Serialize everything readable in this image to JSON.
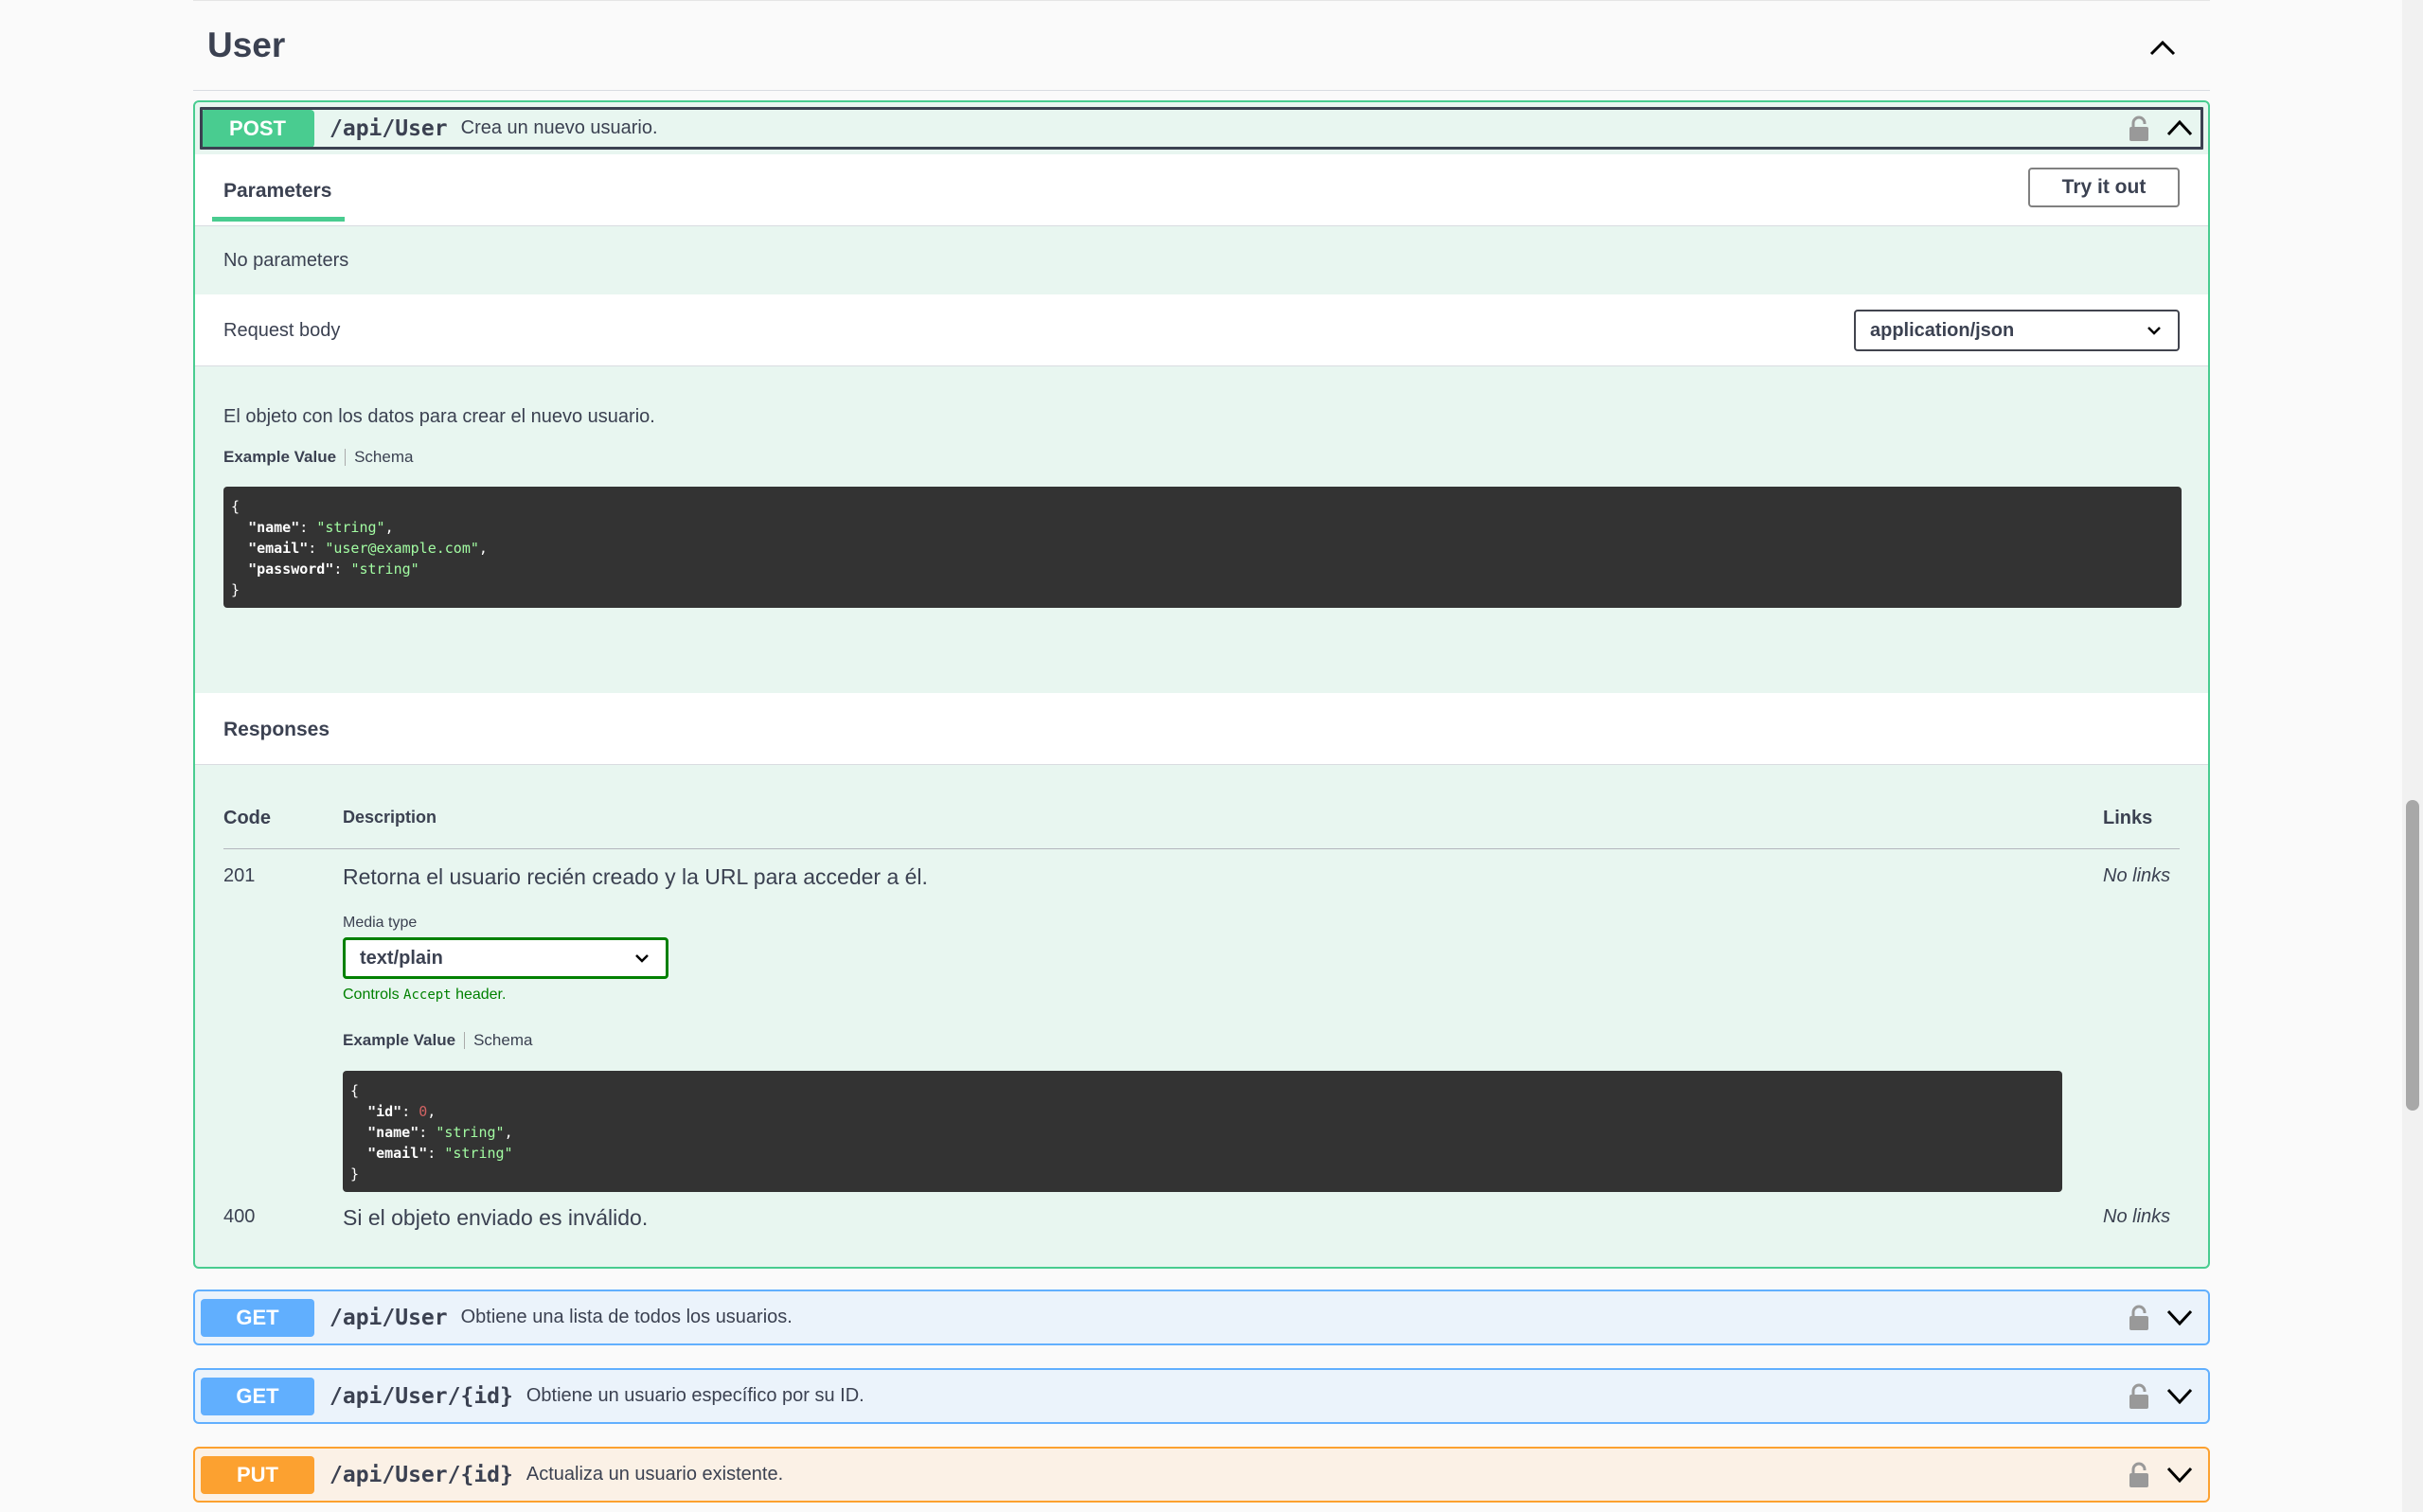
{
  "tag": {
    "title": "User"
  },
  "operations": [
    {
      "method": "POST",
      "path": "/api/User",
      "description": "Crea un nuevo usuario."
    },
    {
      "method": "GET",
      "path": "/api/User",
      "description": "Obtiene una lista de todos los usuarios."
    },
    {
      "method": "GET",
      "path": "/api/User/{id}",
      "description": "Obtiene un usuario específico por su ID."
    },
    {
      "method": "PUT",
      "path": "/api/User/{id}",
      "description": "Actualiza un usuario existente."
    }
  ],
  "expanded": {
    "parameters_tab": "Parameters",
    "try_button": "Try it out",
    "no_parameters": "No parameters",
    "request_body_label": "Request body",
    "request_content_type": "application/json",
    "request_description": "El objeto con los datos para crear el nuevo usuario.",
    "example_value_label": "Example Value",
    "schema_label": "Schema",
    "request_example": {
      "open": "{",
      "l1k": "\"name\"",
      "l1v": "\"string\"",
      "l2k": "\"email\"",
      "l2v": "\"user@example.com\"",
      "l3k": "\"password\"",
      "l3v": "\"string\"",
      "close": "}"
    },
    "responses_label": "Responses",
    "columns": {
      "code": "Code",
      "description": "Description",
      "links": "Links"
    },
    "responses": [
      {
        "code": "201",
        "description": "Retorna el usuario recién creado y la URL para acceder a él.",
        "links": "No links"
      },
      {
        "code": "400",
        "description": "Si el objeto enviado es inválido.",
        "links": "No links"
      }
    ],
    "media_type_label": "Media type",
    "media_type_value": "text/plain",
    "controls_prefix": "Controls",
    "controls_code": "Accept",
    "controls_suffix": "header.",
    "response_example": {
      "open": "{",
      "l1k": "\"id\"",
      "l1v": "0",
      "l2k": "\"name\"",
      "l2v": "\"string\"",
      "l3k": "\"email\"",
      "l3v": "\"string\"",
      "close": "}"
    }
  },
  "icons": {
    "lock": "lock-icon",
    "chevron_up": "chevron-up-icon",
    "chevron_down": "chevron-down-icon"
  },
  "colors": {
    "post": "#49cc90",
    "get": "#61affe",
    "put": "#fca130",
    "code_bg": "#333333"
  }
}
